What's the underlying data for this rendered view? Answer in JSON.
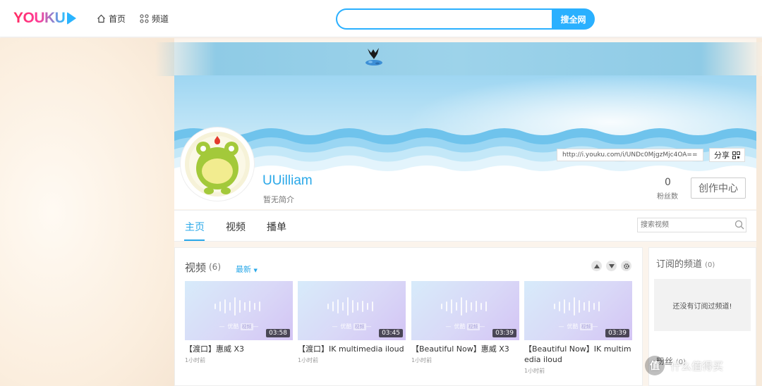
{
  "header": {
    "logo_text": "YOUKU",
    "nav": [
      {
        "label": "首页",
        "icon": "home-icon"
      },
      {
        "label": "频道",
        "icon": "grid-icon"
      }
    ],
    "search": {
      "value": "",
      "placeholder": "",
      "button_label": "搜全网"
    }
  },
  "profile": {
    "channel_url": "http://i.youku.com/i/UNDc0MjgzMjc4OA==",
    "share_label": "分享",
    "username": "UUilliam",
    "intro": "暂无简介",
    "fans_count": "0",
    "fans_label": "粉丝数",
    "creator_button": "创作中心"
  },
  "tabs": {
    "items": [
      {
        "label": "主页",
        "active": true
      },
      {
        "label": "视频",
        "active": false
      },
      {
        "label": "播单",
        "active": false
      }
    ],
    "search_placeholder": "搜索视频"
  },
  "videos": {
    "title": "视频",
    "count": "(6)",
    "sort_label": "最新",
    "items": [
      {
        "title": "【渡口】惠威 X3",
        "duration": "03:58",
        "time": "1小时前"
      },
      {
        "title": "【渡口】IK multimedia iloud",
        "duration": "03:45",
        "time": "1小时前"
      },
      {
        "title": "【Beautiful Now】惠威 X3",
        "duration": "03:39",
        "time": "1小时前"
      },
      {
        "title": "【Beautiful Now】IK multimedia iloud",
        "duration": "03:39",
        "time": "1小时前"
      }
    ],
    "thumb_watermark": "优酷",
    "thumb_tag": "视频"
  },
  "sidebar": {
    "subscribed_title": "订阅的频道",
    "subscribed_count": "(0)",
    "subscribed_empty": "还没有订阅过频道!",
    "fans_title": "粉丝",
    "fans_count": "(0)"
  },
  "site_watermark": "什么值得买",
  "colors": {
    "accent": "#2aa8e8",
    "search_blue": "#2ab0ff"
  }
}
